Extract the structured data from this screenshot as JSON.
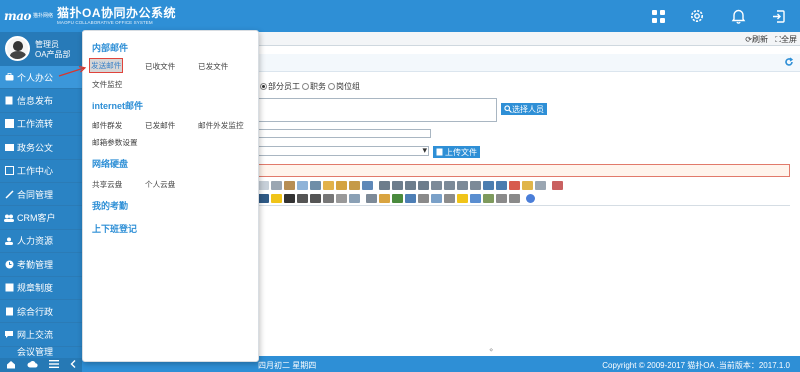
{
  "header": {
    "logo_mark": "mao",
    "logo_brand": "猫扑网络",
    "title": "猫扑OA协同办公系统",
    "subtitle": "MAOPU COLLABORATIVE OFFICE SYSTEM",
    "icons": [
      "apps-icon",
      "settings-icon",
      "bell-icon",
      "logout-icon"
    ]
  },
  "user": {
    "name": "管理员",
    "dept": "OA产品部"
  },
  "sidebar": {
    "items": [
      {
        "label": "个人办公",
        "icon": "briefcase-icon"
      },
      {
        "label": "信息发布",
        "icon": "document-icon"
      },
      {
        "label": "工作流转",
        "icon": "flow-icon"
      },
      {
        "label": "政务公文",
        "icon": "file-icon"
      },
      {
        "label": "工作中心",
        "icon": "inbox-icon"
      },
      {
        "label": "合同管理",
        "icon": "contract-icon"
      },
      {
        "label": "CRM客户",
        "icon": "users-icon"
      },
      {
        "label": "人力资源",
        "icon": "people-icon"
      },
      {
        "label": "考勤管理",
        "icon": "clock-icon"
      },
      {
        "label": "规章制度",
        "icon": "book-icon"
      },
      {
        "label": "综合行政",
        "icon": "building-icon"
      },
      {
        "label": "网上交流",
        "icon": "chat-icon"
      },
      {
        "label": "会议管理",
        "icon": "meeting-icon"
      }
    ]
  },
  "tabbar": {
    "refresh": "刷新",
    "fullscreen": "全屏"
  },
  "form": {
    "range_options": [
      "部分员工",
      "职务",
      "岗位组"
    ],
    "select_recipients": "选择人员",
    "upload": "上传文件"
  },
  "status": {
    "date": "四月初二 星期四",
    "copyright": "Copyright © 2009-2017 猫扑OA .当前版本：2017.1.0"
  },
  "menu": {
    "sections": [
      {
        "title": "内部邮件",
        "links": [
          "发送邮件",
          "已收文件",
          "已发文件",
          "文件监控"
        ]
      },
      {
        "title": "internet邮件",
        "links": [
          "邮件群发",
          "已发邮件",
          "邮件外发监控",
          "邮箱参数设置"
        ]
      },
      {
        "title": "网络硬盘",
        "links": [
          "共享云盘",
          "个人云盘"
        ]
      },
      {
        "title": "我的考勤",
        "links": []
      },
      {
        "title": "上下班登记",
        "links": []
      }
    ],
    "selected": "发送邮件"
  },
  "colors": {
    "primary": "#2e8fd6",
    "sidebar": "#2a83c4",
    "highlight": "#e0443c"
  }
}
